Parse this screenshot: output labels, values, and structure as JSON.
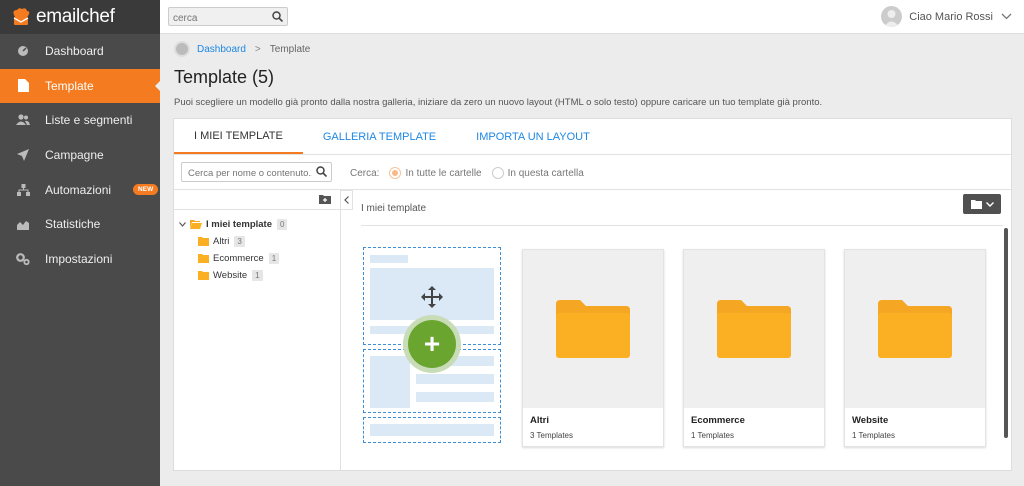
{
  "app": {
    "logo_text": "emailchef"
  },
  "sidebar": {
    "items": [
      {
        "label": "Dashboard",
        "icon": "dashboard-icon",
        "active": false
      },
      {
        "label": "Template",
        "icon": "document-icon",
        "active": true
      },
      {
        "label": "Liste e segmenti",
        "icon": "users-icon",
        "active": false
      },
      {
        "label": "Campagne",
        "icon": "send-icon",
        "active": false
      },
      {
        "label": "Automazioni",
        "icon": "automation-icon",
        "active": false,
        "badge": "NEW"
      },
      {
        "label": "Statistiche",
        "icon": "chart-icon",
        "active": false
      },
      {
        "label": "Impostazioni",
        "icon": "gears-icon",
        "active": false
      }
    ]
  },
  "topbar": {
    "search_placeholder": "cerca",
    "user_greeting": "Ciao Mario Rossi"
  },
  "breadcrumb": {
    "home": "Dashboard",
    "current": "Template"
  },
  "page": {
    "title": "Template (5)",
    "description": "Puoi scegliere un modello già pronto dalla nostra galleria, iniziare da zero un nuovo layout (HTML o solo testo) oppure caricare un tuo template già pronto."
  },
  "tabs": [
    {
      "label": "I MIEI TEMPLATE",
      "active": true
    },
    {
      "label": "GALLERIA TEMPLATE",
      "active": false
    },
    {
      "label": "IMPORTA UN LAYOUT",
      "active": false
    }
  ],
  "filter": {
    "search_placeholder": "Cerca per nome o contenuto...",
    "cerca_label": "Cerca:",
    "option_all": "In tutte le cartelle",
    "option_this": "In questa cartella",
    "selected": "all"
  },
  "tree": {
    "root": {
      "label": "I miei template",
      "count": "0"
    },
    "children": [
      {
        "label": "Altri",
        "count": "3"
      },
      {
        "label": "Ecommerce",
        "count": "1"
      },
      {
        "label": "Website",
        "count": "1"
      }
    ]
  },
  "content": {
    "header_label": "I miei template",
    "folders": [
      {
        "name": "Altri",
        "count": "3 Templates"
      },
      {
        "name": "Ecommerce",
        "count": "1 Templates"
      },
      {
        "name": "Website",
        "count": "1 Templates"
      }
    ]
  },
  "colors": {
    "accent": "#f47b20",
    "link": "#1e88e5",
    "sidebar_bg": "#4a4a4a",
    "folder": "#fbb024",
    "add_green": "#6aa62f"
  }
}
